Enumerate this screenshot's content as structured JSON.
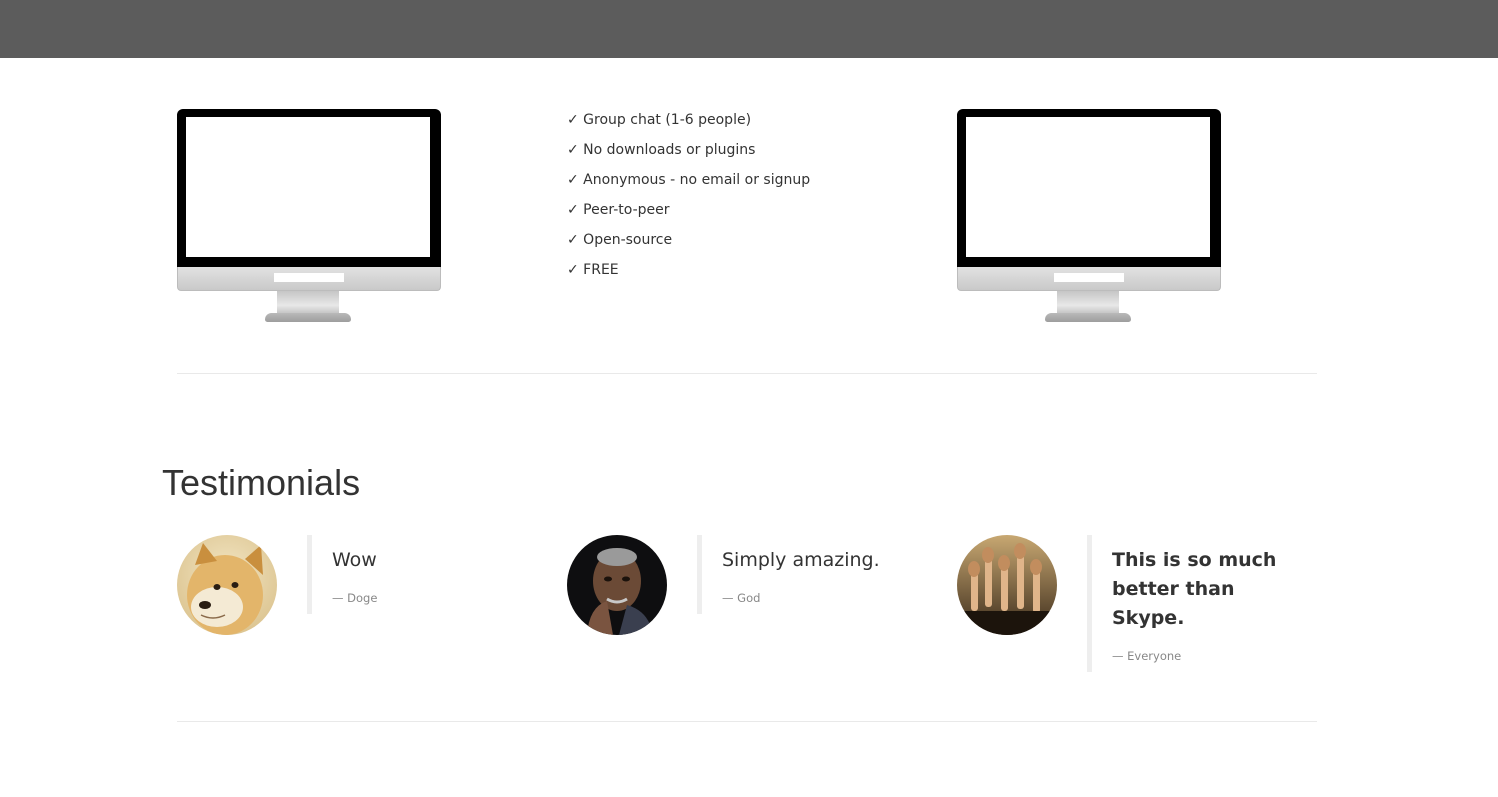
{
  "features": [
    "✓ Group chat (1-6 people)",
    "✓ No downloads or plugins",
    "✓ Anonymous - no email or signup",
    "✓ Peer-to-peer",
    "✓ Open-source",
    "✓ FREE"
  ],
  "testimonials_section": {
    "title": "Testimonials",
    "items": [
      {
        "quote": "Wow",
        "author": "— Doge",
        "avatar": "doge-dog-photo"
      },
      {
        "quote": "Simply amazing.",
        "author": "— God",
        "avatar": "man-portrait-photo"
      },
      {
        "quote": "This is so much better than Skype.",
        "author": "— Everyone",
        "avatar": "raised-hands-crowd-photo"
      }
    ]
  },
  "colors": {
    "topbar": "#5c5c5c",
    "text": "#333333",
    "muted": "#888888",
    "divider": "#e9e9e9"
  }
}
